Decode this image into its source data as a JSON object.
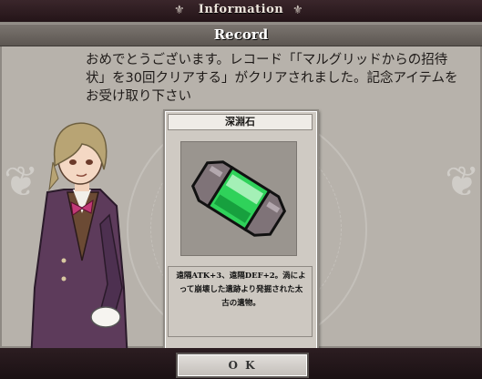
{
  "header": {
    "title": "Information"
  },
  "record": {
    "title": "Record",
    "message": "おめでとうございます。レコード「「マルグリッドからの招待状」を30回クリアする」がクリアされました。記念アイテムをお受け取り下さい"
  },
  "item_card": {
    "name": "深淵石",
    "description": "遠隔ATK+3、遠隔DEF+2。渦によって崩壊した遺跡より発掘された太古の遺物。"
  },
  "footer": {
    "ok_label": "O K"
  },
  "colors": {
    "crystal_green": "#2fd25a",
    "panel_bg": "#b7b2ab"
  }
}
